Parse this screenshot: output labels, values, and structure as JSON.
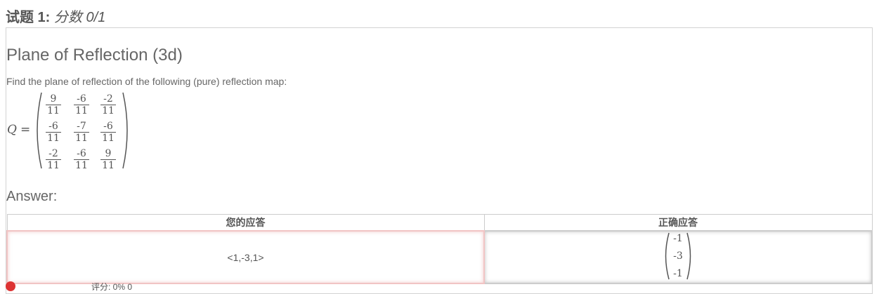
{
  "header": {
    "question_label": "试题 1:",
    "score_text": "分数 0/1"
  },
  "problem": {
    "title": "Plane of Reflection (3d)",
    "prompt": "Find the plane of reflection of the following (pure) reflection map:",
    "matrix_symbol": "Q",
    "equals": "=",
    "matrix": [
      [
        {
          "n": "9",
          "d": "11"
        },
        {
          "n": "-6",
          "d": "11"
        },
        {
          "n": "-2",
          "d": "11"
        }
      ],
      [
        {
          "n": "-6",
          "d": "11"
        },
        {
          "n": "-7",
          "d": "11"
        },
        {
          "n": "-6",
          "d": "11"
        }
      ],
      [
        {
          "n": "-2",
          "d": "11"
        },
        {
          "n": "-6",
          "d": "11"
        },
        {
          "n": "9",
          "d": "11"
        }
      ]
    ]
  },
  "answer": {
    "label": "Answer:",
    "col_yours": "您的应答",
    "col_correct": "正确应答",
    "your_answer": "<1,-3,1>",
    "correct_vector": [
      "-1",
      "-3",
      "-1"
    ]
  },
  "status": {
    "text": "评分: 0% 0"
  }
}
